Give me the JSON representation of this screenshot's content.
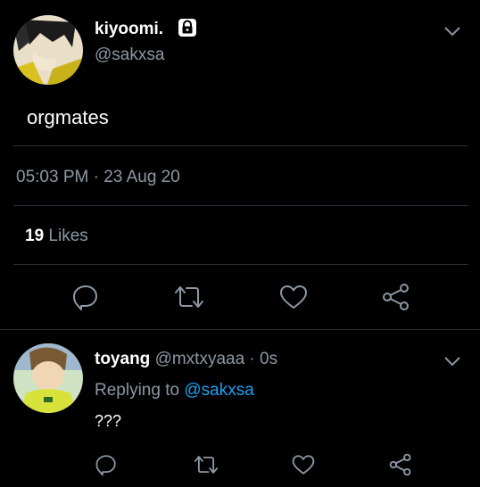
{
  "main_tweet": {
    "display_name": "kiyoomi.",
    "handle": "@sakxsa",
    "text": "orgmates",
    "timestamp": "05:03 PM · 23 Aug 20",
    "likes_count": "19",
    "likes_label": "Likes"
  },
  "reply": {
    "display_name": "toyang",
    "handle_time": "@mxtxyaaa · 0s",
    "replying_prefix": "Replying to",
    "replying_handle": "@sakxsa",
    "text": "???"
  },
  "icons": [
    "lock-icon",
    "chevron-down-icon",
    "reply-icon",
    "retweet-icon",
    "like-icon",
    "share-icon"
  ],
  "colors": {
    "background": "#000000",
    "muted": "#8b98a5",
    "accent": "#1da1f2",
    "divider": "#2a2f33"
  }
}
